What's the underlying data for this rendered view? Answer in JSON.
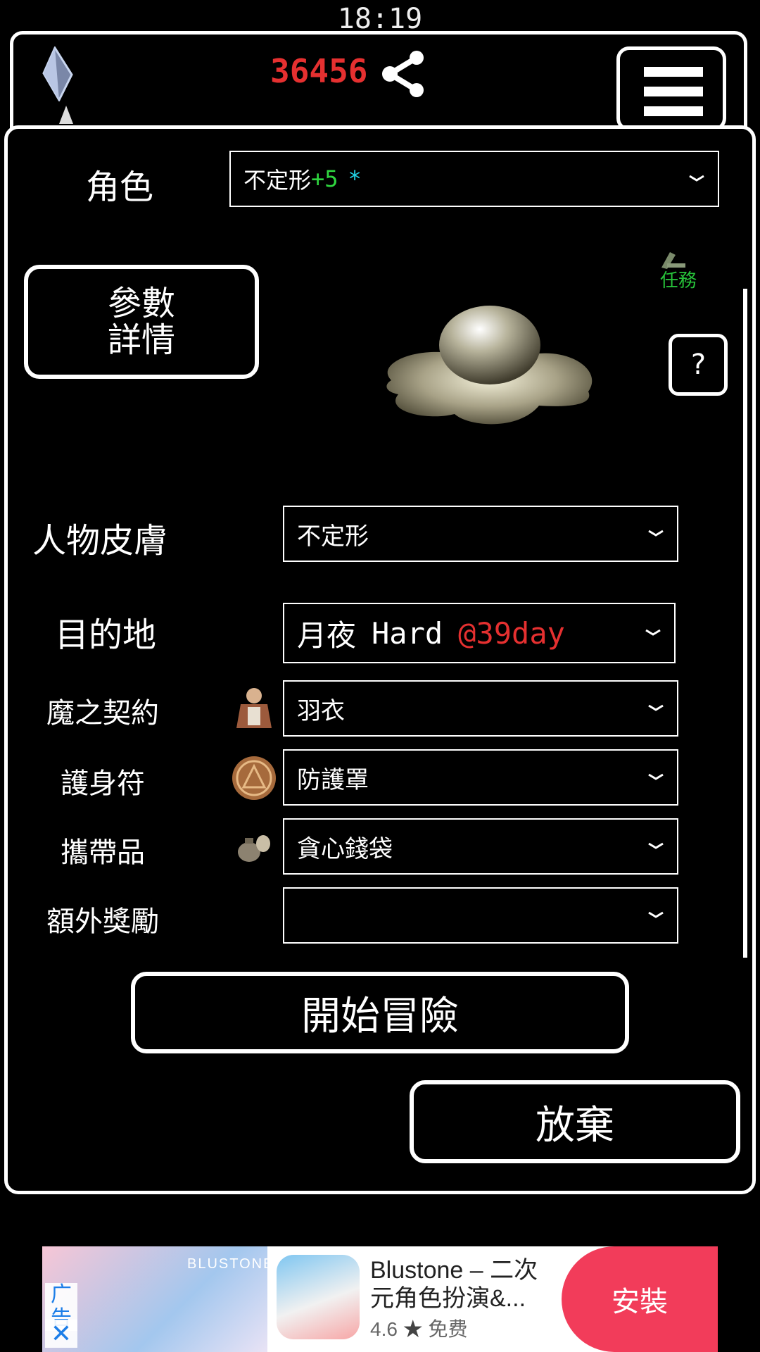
{
  "status": {
    "time": "18:19"
  },
  "top": {
    "currency": "36456"
  },
  "panel": {
    "character": {
      "label": "角色",
      "name": "不定形",
      "level": "+5",
      "mark": "*"
    },
    "params_button": {
      "line1": "參數",
      "line2": "詳情"
    },
    "quest_label": "任務",
    "help_label": "?",
    "skin": {
      "label": "人物皮膚",
      "value": "不定形"
    },
    "destination": {
      "label": "目的地",
      "place": "月夜",
      "difficulty": "Hard",
      "day": "@39day"
    },
    "contract": {
      "label": "魔之契約",
      "value": "羽衣"
    },
    "amulet": {
      "label": "護身符",
      "value": "防護罩"
    },
    "carry": {
      "label": "攜帶品",
      "value": "貪心錢袋"
    },
    "bonus": {
      "label": "額外獎勵",
      "value": ""
    },
    "start_button": "開始冒險",
    "giveup_button": "放棄"
  },
  "ad": {
    "banner_text": "BLUSTONE",
    "title": "Blustone – 二次元角色扮演&...",
    "rating": "4.6",
    "star": "★",
    "price": "免费",
    "install": "安裝",
    "tag": "广告",
    "close": "✕"
  },
  "colors": {
    "accent_red": "#e53030",
    "level_green": "#2fd63f",
    "mark_cyan": "#22d3e6",
    "quest_green": "#27c23a",
    "ad_install": "#f23c5a"
  }
}
